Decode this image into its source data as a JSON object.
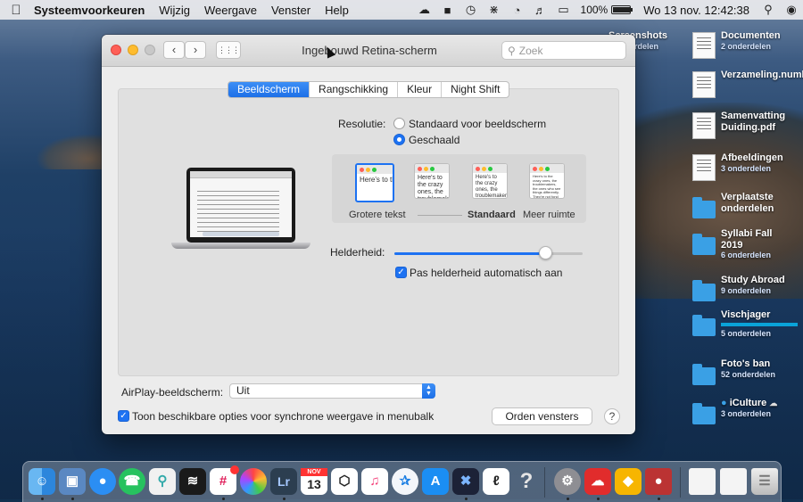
{
  "menubar": {
    "apple_icon": "apple-logo-icon",
    "app_name": "Systeemvoorkeuren",
    "menus": [
      "Wijzig",
      "Weergave",
      "Venster",
      "Help"
    ],
    "status_icons": [
      "creative-cloud-icon",
      "contacts-icon",
      "time-machine-icon",
      "bluetooth-icon",
      "wifi-icon",
      "volume-icon",
      "airplay-icon"
    ],
    "battery_percent": "100%",
    "battery_level": 1.0,
    "clock": "Wo 13 nov.  12:42:38",
    "search_icon": "spotlight-icon",
    "siri_icon": "siri-icon"
  },
  "desktop": {
    "items": [
      {
        "name": "Screenshots",
        "sub": "5 onderdelen"
      },
      {
        "name": "Documenten",
        "sub": "2 onderdelen"
      },
      {
        "name": "Verzameling.numbers",
        "sub": ""
      },
      {
        "name": "Samenvatting Duiding.pdf",
        "sub": ""
      },
      {
        "name": "Afbeeldingen",
        "sub": "3 onderdelen"
      },
      {
        "name": "Verplaatste onderdelen",
        "sub": ""
      },
      {
        "name": "Syllabi Fall 2019",
        "sub": "6 onderdelen"
      },
      {
        "name": "Study Abroad",
        "sub": "9 onderdelen"
      },
      {
        "name": "Vischjager",
        "sub": "5 onderdelen"
      },
      {
        "name": "Foto's ban",
        "sub": "52 onderdelen"
      },
      {
        "name": "iCulture",
        "sub": "3 onderdelen"
      }
    ]
  },
  "window": {
    "title": "Ingebouwd Retina-scherm",
    "search_placeholder": "Zoek",
    "tabs": [
      "Beeldscherm",
      "Rangschikking",
      "Kleur",
      "Night Shift"
    ],
    "resolution_label": "Resolutie:",
    "resolution_options": [
      "Standaard voor beeldscherm",
      "Geschaald"
    ],
    "scale_labels": {
      "larger": "Grotere tekst",
      "default": "Standaard",
      "more": "Meer ruimte"
    },
    "thumb_text": "Here's to the crazy ones, the troublemakers, the ones who see things differently. They're not fond of rules. And they have no respect for the status quo.",
    "brightness_label": "Helderheid:",
    "brightness_value": 0.8,
    "auto_brightness_label": "Pas helderheid automatisch aan",
    "airplay_label": "AirPlay-beeldscherm:",
    "airplay_value": "Uit",
    "mirror_label": "Toon beschikbare opties voor synchrone weergave in menubalk",
    "arrange_button": "Orden vensters",
    "help_button": "?"
  },
  "dock": {
    "lightroom_label": "Lr",
    "calendar_month": "NOV",
    "calendar_day": "13",
    "apps": [
      "finder",
      "preview",
      "messages",
      "whatsapp",
      "maps-photo",
      "stocks",
      "slack",
      "photos",
      "lightroom",
      "calendar",
      "unity",
      "itunes",
      "safari",
      "app-store",
      "xmind",
      "scrivener",
      "help",
      "system-preferences",
      "creative-cloud",
      "sketch",
      "photo-booth",
      "finder-window-1",
      "finder-window-2",
      "trash"
    ]
  }
}
